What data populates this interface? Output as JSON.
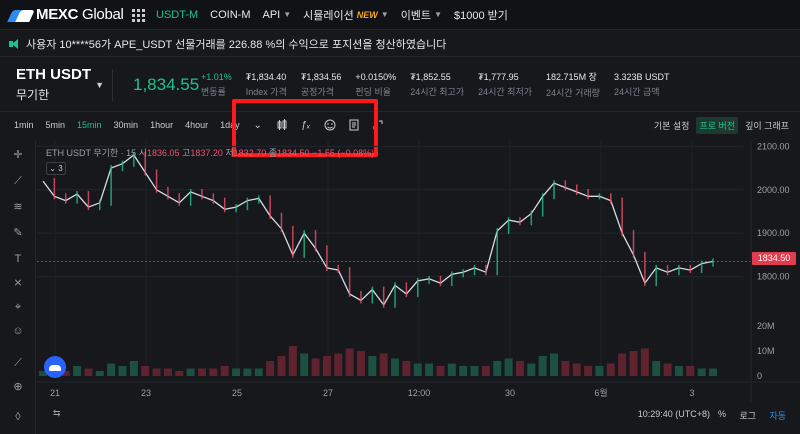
{
  "nav": {
    "logo_bold": "MEXC",
    "logo_light": "Global",
    "items": [
      {
        "label": "USDT-M",
        "active": true
      },
      {
        "label": "COIN-M"
      },
      {
        "label": "API",
        "caret": true
      },
      {
        "label": "시뮬레이션",
        "badge": "NEW",
        "caret": true
      },
      {
        "label": "이벤트",
        "caret": true
      },
      {
        "label": "$1000 받기"
      }
    ]
  },
  "notice": {
    "text": "사용자 10****56가 APE_USDT 선물거래를 226.88 %의 수익으로 포지션을 청산하였습니다"
  },
  "ticker": {
    "symbol": "ETH USDT",
    "subtitle": "무기한",
    "last_price": "1,834.55",
    "stats": [
      {
        "value": "+1.01%",
        "label": "변동률",
        "green": true
      },
      {
        "value": "₮1,834.40",
        "label": "Index 가격"
      },
      {
        "value": "₮1,834.56",
        "label": "공정가격"
      },
      {
        "value": "+0.0150%",
        "label": "펀딩 비율"
      },
      {
        "value": "₮1,852.55",
        "label": "24시간 최고가"
      },
      {
        "value": "₮1,777.95",
        "label": "24시간 최저가"
      },
      {
        "value": "182.715M 장",
        "label": "24시간 거래량"
      },
      {
        "value": "3.323B USDT",
        "label": "24시간 금액"
      }
    ]
  },
  "toolbar": {
    "timeframes": [
      "1min",
      "5min",
      "15min",
      "30min",
      "1hour",
      "4hour",
      "1day"
    ],
    "active_timeframe": "15min",
    "right_options": [
      {
        "label": "기본 설정"
      },
      {
        "label": "프로 버전",
        "active": true
      },
      {
        "label": "깊이 그래프"
      }
    ]
  },
  "legend": {
    "symbol": "ETH USDT 무기한 · 15",
    "open_label": "시",
    "open_value": "1836.05",
    "high_label": "고",
    "high_value": "1837.20",
    "low_label": "저",
    "low_value": "1832.70",
    "close_label": "종",
    "close_value": "1834.50",
    "change": "−1.55 (−0.08%)",
    "collapse_count": "3"
  },
  "price_axis": [
    "2100.00",
    "2000.00",
    "1900.00",
    "1800.00"
  ],
  "volume_axis": [
    "20M",
    "10M",
    "0"
  ],
  "time_axis": [
    "21",
    "23",
    "25",
    "27",
    "12:00",
    "30",
    "6월",
    "3"
  ],
  "price_tag": "1834.50",
  "bottom": {
    "time": "10:29:40 (UTC+8)",
    "pct": "%",
    "log": "로그",
    "auto": "자동"
  },
  "chart_data": {
    "type": "line",
    "title": "",
    "ylim": [
      1700,
      2110
    ],
    "series": [
      {
        "values": [
          2020,
          1985,
          1975,
          1990,
          1960,
          1970,
          2050,
          2060,
          2080,
          2040,
          2000,
          1985,
          1970,
          1995,
          1985,
          1975,
          1955,
          1960,
          1975,
          1980,
          1940,
          1910,
          1850,
          1900,
          1865,
          1820,
          1815,
          1760,
          1745,
          1770,
          1735,
          1780,
          1760,
          1790,
          1795,
          1785,
          1805,
          1810,
          1820,
          1810,
          1905,
          1930,
          1925,
          1945,
          1985,
          2015,
          2005,
          1995,
          1985,
          1985,
          1975,
          1900,
          1850,
          1785,
          1820,
          1810,
          1820,
          1815,
          1830,
          1835
        ]
      }
    ],
    "volume": [
      2,
      3,
      2,
      4,
      3,
      2,
      5,
      4,
      6,
      4,
      3,
      3,
      2,
      3,
      3,
      3,
      4,
      3,
      3,
      3,
      6,
      8,
      12,
      9,
      7,
      8,
      9,
      11,
      10,
      8,
      9,
      7,
      6,
      5,
      5,
      4,
      5,
      4,
      4,
      4,
      6,
      7,
      6,
      5,
      8,
      9,
      6,
      5,
      4,
      4,
      5,
      9,
      10,
      11,
      6,
      5,
      4,
      4,
      3,
      3
    ],
    "grid": true
  }
}
